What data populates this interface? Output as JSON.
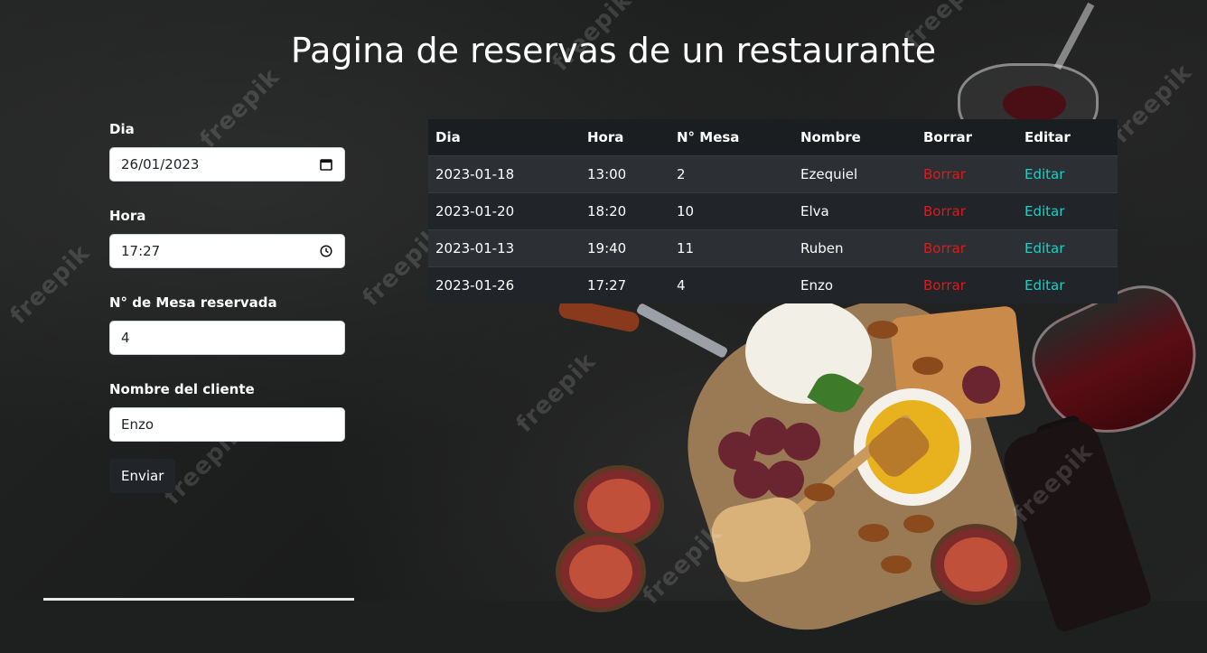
{
  "page": {
    "title": "Pagina de reservas de un restaurante"
  },
  "form": {
    "dia_label": "Dia",
    "dia_value": "26/01/2023",
    "hora_label": "Hora",
    "hora_value": "17:27",
    "mesa_label": "N° de Mesa reservada",
    "mesa_value": "4",
    "nombre_label": "Nombre del cliente",
    "nombre_value": "Enzo",
    "submit_label": "Enviar"
  },
  "table": {
    "headers": [
      "Dia",
      "Hora",
      "N° Mesa",
      "Nombre",
      "Borrar",
      "Editar"
    ],
    "rows": [
      {
        "dia": "2023-01-18",
        "hora": "13:00",
        "mesa": "2",
        "nombre": "Ezequiel",
        "borrar": "Borrar",
        "editar": "Editar"
      },
      {
        "dia": "2023-01-20",
        "hora": "18:20",
        "mesa": "10",
        "nombre": "Elva",
        "borrar": "Borrar",
        "editar": "Editar"
      },
      {
        "dia": "2023-01-13",
        "hora": "19:40",
        "mesa": "11",
        "nombre": "Ruben",
        "borrar": "Borrar",
        "editar": "Editar"
      },
      {
        "dia": "2023-01-26",
        "hora": "17:27",
        "mesa": "4",
        "nombre": "Enzo",
        "borrar": "Borrar",
        "editar": "Editar"
      }
    ]
  },
  "background": {
    "watermark": "freepik"
  },
  "colors": {
    "borrar": "#dc1a1a",
    "editar": "#1ad0c6",
    "table_dark": "#212529",
    "table_striped": "#2c3034"
  },
  "icons": {
    "date": "calendar-icon",
    "time": "clock-icon"
  }
}
